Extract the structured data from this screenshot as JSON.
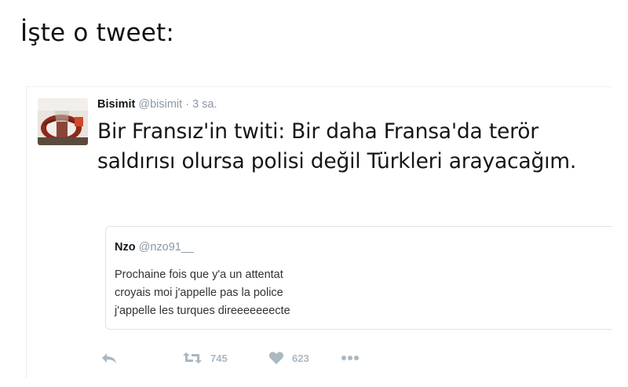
{
  "headline": "İşte o tweet:",
  "tweet": {
    "display_name": "Bisimit",
    "handle": "@bisimit",
    "separator": "·",
    "time": "3 sa.",
    "text": "Bir Fransız'in twiti: Bir daha Fransa'da terör saldırısı olursa polisi değil Türkleri arayacağım.",
    "avatar_icon": "tea-glass-icon"
  },
  "quote": {
    "display_name": "Nzo",
    "handle": "@nzo91__",
    "lines": [
      "Prochaine fois que y'a un attentat",
      "croyais moi j'appelle pas la police",
      "j'appelle les turques direeeeeeecte"
    ]
  },
  "actions": {
    "reply_icon": "reply-icon",
    "retweet_icon": "retweet-icon",
    "retweet_count": "745",
    "like_icon": "heart-icon",
    "like_count": "623",
    "more_icon": "more-dots-icon"
  },
  "colors": {
    "text": "#14171a",
    "muted": "#8b98a5",
    "action": "#aab8c2",
    "border": "#dfe3e7"
  }
}
